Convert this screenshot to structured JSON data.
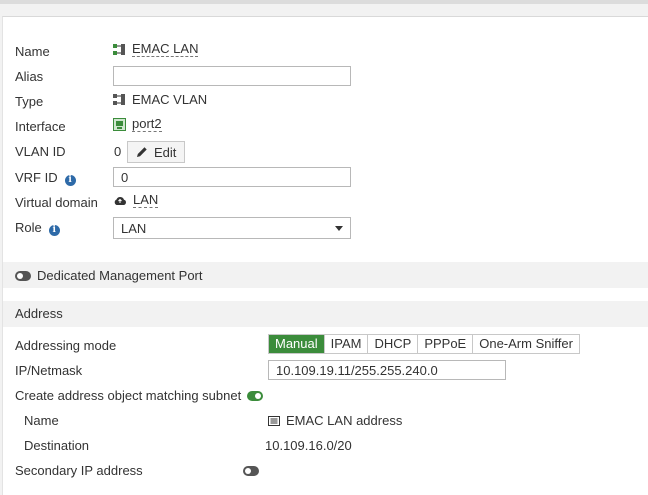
{
  "fields": {
    "name": {
      "label": "Name",
      "value": "EMAC LAN"
    },
    "alias": {
      "label": "Alias",
      "value": ""
    },
    "type": {
      "label": "Type",
      "value": "EMAC VLAN"
    },
    "interface": {
      "label": "Interface",
      "value": "port2"
    },
    "vlan_id": {
      "label": "VLAN ID",
      "value": "0",
      "edit_label": "Edit"
    },
    "vrf_id": {
      "label": "VRF ID",
      "value": "0"
    },
    "virtual_domain": {
      "label": "Virtual domain",
      "value": "LAN"
    },
    "role": {
      "label": "Role",
      "value": "LAN"
    }
  },
  "dedicated_management_port": {
    "label": "Dedicated Management Port",
    "enabled": false
  },
  "address": {
    "section_title": "Address",
    "addressing_mode": {
      "label": "Addressing mode",
      "options": [
        "Manual",
        "IPAM",
        "DHCP",
        "PPPoE",
        "One-Arm Sniffer"
      ],
      "selected": "Manual"
    },
    "ip_netmask": {
      "label": "IP/Netmask",
      "value": "10.109.19.11/255.255.240.0"
    },
    "create_object": {
      "label": "Create address object matching subnet",
      "enabled": true
    },
    "object_name": {
      "label": "Name",
      "value": "EMAC LAN address"
    },
    "destination": {
      "label": "Destination",
      "value": "10.109.16.0/20"
    },
    "secondary_ip": {
      "label": "Secondary IP address",
      "enabled": false
    }
  },
  "icons": {
    "type_icon": "emac-vlan-icon",
    "port_icon": "port-icon",
    "vdom_icon": "cloud-icon",
    "address_icon": "address-object-icon"
  },
  "colors": {
    "accent_green": "#3b8c3b",
    "info_blue": "#2e6aa8"
  }
}
